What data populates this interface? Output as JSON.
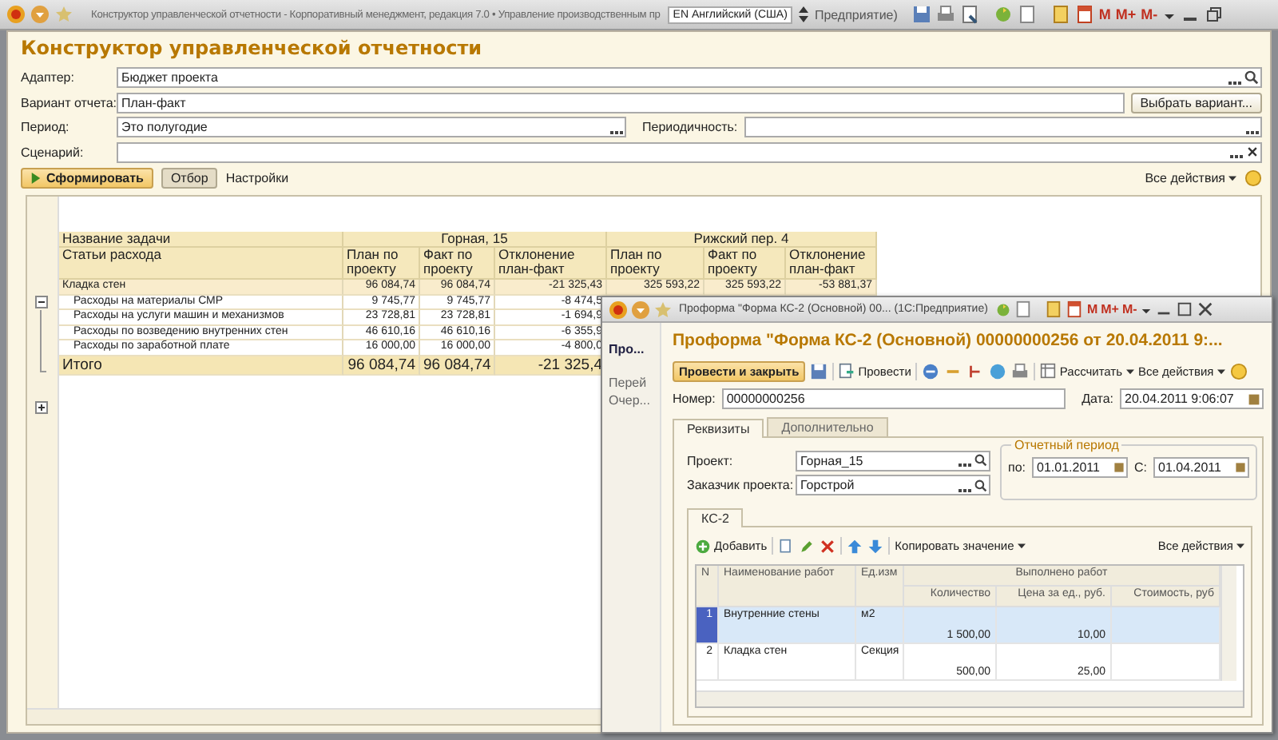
{
  "window": {
    "title": "Конструктор управленческой отчетности - Корпоративный менеджмент, редакция 7.0 • Управление производственным пр",
    "language": "EN Английский (США)",
    "title_tail": "Предприятие)",
    "memory_keys": [
      "M",
      "M+",
      "M-"
    ]
  },
  "form": {
    "title": "Конструктор управленческой отчетности",
    "adapter": {
      "label": "Адаптер:",
      "value": "Бюджет проекта"
    },
    "variant": {
      "label": "Вариант отчета:",
      "value": "План-факт",
      "button": "Выбрать вариант..."
    },
    "period": {
      "label": "Период:",
      "value": "Это полугодие"
    },
    "periodicity": {
      "label": "Периодичность:"
    },
    "scenario": {
      "label": "Сценарий:"
    },
    "actions": {
      "generate": "Сформировать",
      "filter": "Отбор",
      "settings": "Настройки",
      "all_actions": "Все действия"
    }
  },
  "report": {
    "task_header": "Название задачи",
    "groups": [
      "Горная, 15",
      "Рижский пер. 4"
    ],
    "article_header": "Статьи расхода",
    "columns": [
      "План по проекту",
      "Факт по проекту",
      "Отклонение план-факт",
      "План по проекту",
      "Факт по проекту",
      "Отклонение план-факт"
    ],
    "rows": [
      {
        "kind": "group",
        "name": "Кладка стен",
        "values": [
          "96 084,74",
          "96 084,74",
          "-21 325,43",
          "325 593,22",
          "325 593,22",
          "-53 881,37"
        ]
      },
      {
        "kind": "item",
        "name": "Расходы на материалы СМР",
        "values": [
          "9 745,77",
          "9 745,77",
          "-8 474,5"
        ]
      },
      {
        "kind": "item",
        "name": "Расходы на услуги машин и механизмов",
        "values": [
          "23 728,81",
          "23 728,81",
          "-1 694,9"
        ]
      },
      {
        "kind": "item",
        "name": "Расходы по возведению внутренних стен",
        "values": [
          "46 610,16",
          "46 610,16",
          "-6 355,9"
        ]
      },
      {
        "kind": "item",
        "name": "Расходы по заработной плате",
        "values": [
          "16 000,00",
          "16 000,00",
          "-4 800,0"
        ]
      },
      {
        "kind": "total",
        "name": "Итого",
        "values": [
          "96 084,74",
          "96 084,74",
          "-21 325,4"
        ]
      }
    ]
  },
  "dialog": {
    "title": "Проформа \"Форма КС-2 (Основной) 00... (1С:Предприятие)",
    "memory_keys": [
      "M",
      "M+",
      "M-"
    ],
    "nav": [
      "Про...",
      "Перей",
      "Очер..."
    ],
    "heading": "Проформа \"Форма КС-2 (Основной)  00000000256 от 20.04.2011 9:...",
    "actions": {
      "post_close": "Провести и закрыть",
      "post": "Провести",
      "calculate": "Рассчитать",
      "all_actions": "Все действия"
    },
    "number": {
      "label": "Номер:",
      "value": "00000000256"
    },
    "date": {
      "label": "Дата:",
      "value": "20.04.2011  9:06:07"
    },
    "tabs": [
      {
        "label": "Реквизиты",
        "selected": true
      },
      {
        "label": "Дополнительно",
        "selected": false
      }
    ],
    "project": {
      "label": "Проект:",
      "value": "Горная_15"
    },
    "customer": {
      "label": "Заказчик проекта:",
      "value": "Горстрой"
    },
    "period": {
      "title": "Отчетный период",
      "to": {
        "label": "по:",
        "value": "01.01.2011"
      },
      "from": {
        "label": "С:",
        "value": "01.04.2011"
      }
    },
    "inner_tabs": [
      {
        "label": "КС-2",
        "selected": true
      }
    ],
    "table_actions": {
      "add": "Добавить",
      "copy": "Копировать значение",
      "all_actions": "Все действия"
    },
    "table": {
      "columns": [
        "N",
        "Наименование работ",
        "Ед.изм",
        "Выполнено работ",
        "Количество",
        "Цена за ед., руб.",
        "Стоимость, руб"
      ],
      "rows": [
        {
          "n": "1",
          "name": "Внутренние стены",
          "unit": "м2",
          "qty": "1 500,00",
          "price": "10,00",
          "selected": true
        },
        {
          "n": "2",
          "name": "Кладка стен",
          "unit": "Секция",
          "qty": "500,00",
          "price": "25,00",
          "selected": false
        }
      ]
    }
  }
}
